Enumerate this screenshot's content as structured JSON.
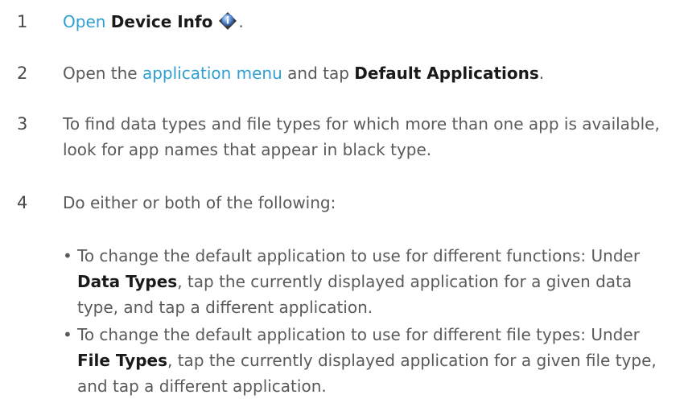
{
  "steps": [
    {
      "number": "1",
      "link": "Open",
      "bold": "Device Info",
      "icon": "device-info-icon",
      "end": "."
    },
    {
      "number": "2",
      "pre": "Open the ",
      "link": "application menu",
      "mid": " and tap ",
      "bold": "Default Applications",
      "end": "."
    },
    {
      "number": "3",
      "text": "To find data types and file types for which more than one app is available, look for app names that appear in black type."
    },
    {
      "number": "4",
      "text": "Do either or both of the following:"
    }
  ],
  "bullets": [
    {
      "lead": "To change the default application to use for different functions: Under ",
      "bold": "Data Types",
      "rest": ", tap the currently displayed application for a given data type, and tap a different application."
    },
    {
      "lead": "To change the default application to use for different file types: Under ",
      "bold": "File Types",
      "rest": ", tap the currently displayed application for a given file type, and tap a different application."
    }
  ],
  "colors": {
    "link": "#2f9fd1",
    "text": "#5a5a5a",
    "bold": "#1a1a1a"
  }
}
